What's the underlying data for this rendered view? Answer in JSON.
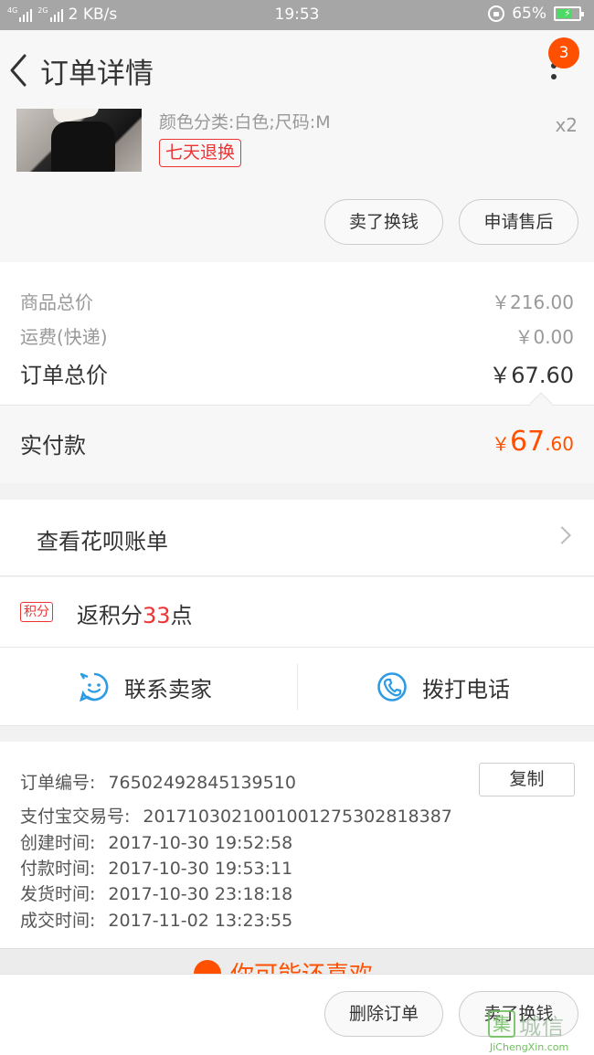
{
  "status_bar": {
    "network_1": "4G",
    "network_2": "4G",
    "network_3": "2G",
    "speed": "2 KB/s",
    "time": "19:53",
    "battery": "65%"
  },
  "header": {
    "title": "订单详情",
    "badge_count": "3"
  },
  "product": {
    "sku": "颜色分类:白色;尺码:M",
    "quantity": "x2",
    "return_tag": "七天退换",
    "actions": [
      "卖了换钱",
      "申请售后"
    ]
  },
  "prices": {
    "items_label": "商品总价",
    "items_value": "￥216.00",
    "shipping_label": "运费(快递)",
    "shipping_value": "￥0.00",
    "total_label": "订单总价",
    "total_value": "￥67.60"
  },
  "paid": {
    "label": "实付款",
    "currency": "￥",
    "integer": "67",
    "decimal": ".60"
  },
  "huabei": {
    "label": "查看花呗账单"
  },
  "points": {
    "tag": "积分",
    "prefix": "返积分",
    "amount": "33",
    "suffix": "点"
  },
  "contact": {
    "seller_label": "联系卖家",
    "phone_label": "拨打电话",
    "accent_color": "#2d9be3"
  },
  "order_info": {
    "copy_label": "复制",
    "rows": [
      {
        "label": "订单编号:",
        "value": "76502492845139510"
      },
      {
        "label": "支付宝交易号:",
        "value": "2017103021001001275302818387"
      },
      {
        "label": "创建时间:",
        "value": "2017-10-30 19:52:58"
      },
      {
        "label": "付款时间:",
        "value": "2017-10-30 19:53:11"
      },
      {
        "label": "发货时间:",
        "value": "2017-10-30 23:18:18"
      },
      {
        "label": "成交时间:",
        "value": "2017-11-02 13:23:55"
      }
    ]
  },
  "recommend": {
    "title": "你可能还喜欢"
  },
  "bottom_bar": {
    "delete_label": "删除订单",
    "sell_label": "卖了换钱"
  },
  "watermark": {
    "cn": "城信",
    "en": "JiChengXin.com"
  },
  "colors": {
    "accent": "#ff5000",
    "tag_red": "#e33333",
    "status_bar": "#a6a6a6"
  }
}
